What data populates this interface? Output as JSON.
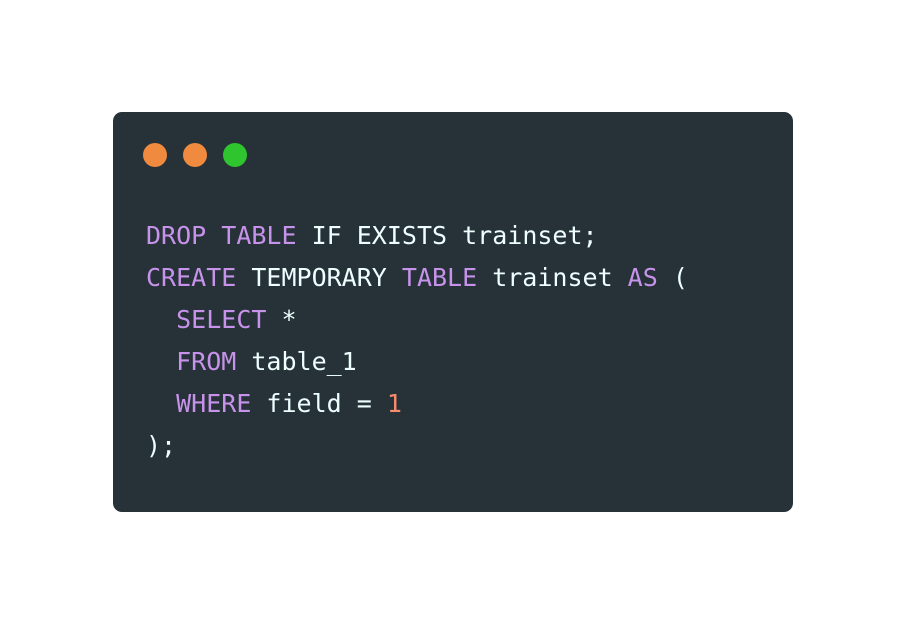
{
  "window_controls": {
    "close_color": "#f08a3e",
    "minimize_color": "#f08a3e",
    "maximize_color": "#2ec52e",
    "icons": [
      "close-dot-icon",
      "minimize-dot-icon",
      "maximize-dot-icon"
    ]
  },
  "code": {
    "language": "SQL",
    "colors": {
      "background": "#263238",
      "keyword": "#c792ea",
      "text": "#eeffff",
      "number": "#f78c6c"
    },
    "lines": [
      {
        "tokens": [
          {
            "t": "DROP",
            "k": "kw"
          },
          {
            "t": " ",
            "k": "plain"
          },
          {
            "t": "TABLE",
            "k": "kw"
          },
          {
            "t": " IF EXISTS trainset;",
            "k": "plain"
          }
        ]
      },
      {
        "tokens": [
          {
            "t": "CREATE",
            "k": "kw"
          },
          {
            "t": " TEMPORARY ",
            "k": "plain"
          },
          {
            "t": "TABLE",
            "k": "kw"
          },
          {
            "t": " trainset ",
            "k": "plain"
          },
          {
            "t": "AS",
            "k": "kw"
          },
          {
            "t": " (",
            "k": "plain"
          }
        ]
      },
      {
        "tokens": [
          {
            "t": "  ",
            "k": "plain"
          },
          {
            "t": "SELECT",
            "k": "kw"
          },
          {
            "t": " *",
            "k": "plain"
          }
        ]
      },
      {
        "tokens": [
          {
            "t": "  ",
            "k": "plain"
          },
          {
            "t": "FROM",
            "k": "kw"
          },
          {
            "t": " table_1",
            "k": "plain"
          }
        ]
      },
      {
        "tokens": [
          {
            "t": "  ",
            "k": "plain"
          },
          {
            "t": "WHERE",
            "k": "kw"
          },
          {
            "t": " field = ",
            "k": "plain"
          },
          {
            "t": "1",
            "k": "num"
          }
        ]
      },
      {
        "tokens": [
          {
            "t": ");",
            "k": "plain"
          }
        ]
      }
    ]
  }
}
